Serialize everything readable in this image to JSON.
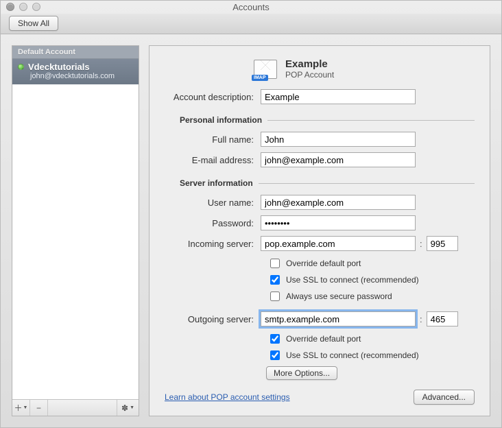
{
  "window": {
    "title": "Accounts"
  },
  "toolbar": {
    "show_all": "Show All"
  },
  "sidebar": {
    "header": "Default Account",
    "account": {
      "name": "Vdecktutorials",
      "email": "john@vdecktutorials.com"
    }
  },
  "panel": {
    "header": {
      "title": "Example",
      "subtitle": "POP Account",
      "badge": "IMAP"
    },
    "labels": {
      "account_description": "Account description:",
      "personal_information": "Personal information",
      "full_name": "Full name:",
      "email_address": "E-mail address:",
      "server_information": "Server information",
      "user_name": "User name:",
      "password": "Password:",
      "incoming_server": "Incoming server:",
      "outgoing_server": "Outgoing server:",
      "override_port": "Override default port",
      "use_ssl": "Use SSL to connect (recommended)",
      "secure_password": "Always use secure password",
      "more_options": "More Options...",
      "learn_link": "Learn about POP account settings",
      "advanced": "Advanced..."
    },
    "values": {
      "account_description": "Example",
      "full_name": "John",
      "email_address": "john@example.com",
      "user_name": "john@example.com",
      "password": "••••••••",
      "incoming_server": "pop.example.com",
      "incoming_port": "995",
      "outgoing_server": "smtp.example.com",
      "outgoing_port": "465"
    },
    "checks": {
      "in_override": false,
      "in_ssl": true,
      "in_secure_pw": false,
      "out_override": true,
      "out_ssl": true
    }
  }
}
